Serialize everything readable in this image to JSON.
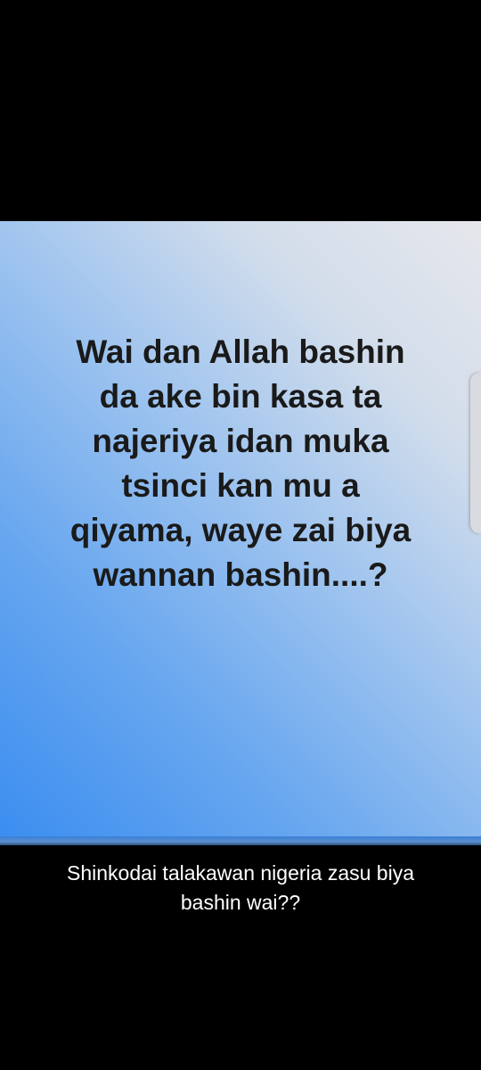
{
  "post": {
    "text_lines": [
      "Wai dan Allah bashin",
      "da ake bin kasa ta",
      "najeriya idan muka",
      "tsinci kan mu a",
      "qiyama, waye zai biya",
      "wannan bashin....?"
    ],
    "background_colors": [
      "#3a8df0",
      "#e6e7ec"
    ],
    "text_color": "#1a1a1a"
  },
  "caption": {
    "lines": [
      "Shinkodai talakawan nigeria zasu biya",
      "bashin wai??"
    ],
    "text_color": "#ffffff"
  }
}
